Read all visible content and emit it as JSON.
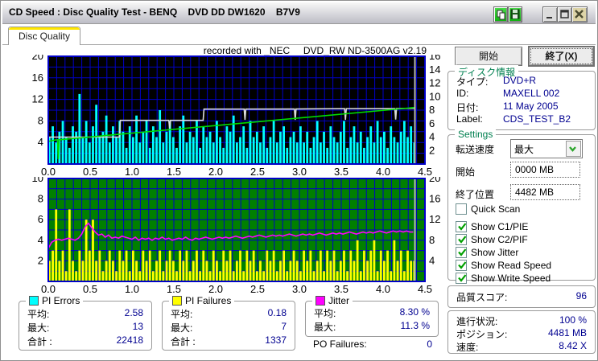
{
  "window": {
    "title": "CD Speed : Disc Quality Test - BENQ    DVD DD DW1620    B7V9",
    "controls": [
      "copy-icon",
      "save-icon",
      "minimize-icon",
      "maximize-icon",
      "close-icon"
    ]
  },
  "tab": {
    "label": "Disc Quality"
  },
  "recorded_with": "recorded with _NEC     DVD_RW ND-3500AG v2.19",
  "chart_data": [
    {
      "type": "bar",
      "name": "PI Errors with read/write speed overlay",
      "x_unit": "GB",
      "x_step": 0.04,
      "xlim": [
        0,
        4.5
      ],
      "ylim_left": [
        0,
        20
      ],
      "ylim_right": [
        0,
        16
      ],
      "grid_y_step": 2,
      "grid_x_step": 0.1,
      "x_ticks": [
        "0.0",
        "0.5",
        "1.0",
        "1.5",
        "2.0",
        "2.5",
        "3.0",
        "3.5",
        "4.0",
        "4.5"
      ],
      "left_ticks": [
        20,
        16,
        12,
        8,
        4
      ],
      "right_ticks": [
        16,
        14,
        12,
        10,
        8,
        6,
        4,
        2
      ],
      "bg": "#000000",
      "grid_color": "#0000c8",
      "cursor_x": 4.38,
      "cursor_color": "#b8b8b8",
      "bars": {
        "name": "PI Errors",
        "color": "#00ffff",
        "values": [
          5,
          7,
          4,
          6,
          8,
          5,
          3,
          7,
          6,
          13,
          5,
          8,
          4,
          7,
          11,
          5,
          6,
          9,
          4,
          7,
          5,
          8,
          6,
          3,
          7,
          5,
          9,
          4,
          6,
          8,
          3,
          7,
          5,
          10,
          4,
          6,
          8,
          5,
          3,
          7,
          9,
          4,
          6,
          5,
          8,
          3,
          7,
          5,
          6,
          4,
          8,
          5,
          3,
          7,
          6,
          9,
          4,
          5,
          7,
          3,
          8,
          5,
          6,
          4,
          7,
          3,
          5,
          8,
          4,
          6,
          7,
          3,
          5,
          6,
          4,
          7,
          4,
          6,
          3,
          5,
          8,
          4,
          6,
          3,
          7,
          5,
          4,
          6,
          8,
          3,
          5,
          7,
          4,
          6,
          3,
          5,
          7,
          4,
          8,
          5,
          6,
          3,
          7,
          5,
          4,
          6,
          8,
          5,
          7,
          4
        ]
      },
      "lines": [
        {
          "name": "Write Speed",
          "color": "#dcdcdc",
          "axis": "left-units",
          "points": [
            [
              0,
              5.0
            ],
            [
              0.85,
              5.0
            ],
            [
              0.86,
              8.1
            ],
            [
              1.44,
              8.1
            ],
            [
              1.45,
              6.6
            ],
            [
              1.46,
              8.1
            ],
            [
              1.85,
              8.1
            ],
            [
              1.86,
              10.2
            ],
            [
              2.34,
              10.2
            ],
            [
              2.35,
              8.2
            ],
            [
              2.36,
              10.2
            ],
            [
              2.94,
              10.22
            ],
            [
              2.95,
              8.2
            ],
            [
              2.96,
              10.22
            ],
            [
              3.54,
              10.28
            ],
            [
              3.55,
              8.2
            ],
            [
              3.56,
              10.28
            ],
            [
              4.14,
              10.3
            ],
            [
              4.15,
              8.25
            ],
            [
              4.16,
              10.3
            ],
            [
              4.38,
              10.35
            ]
          ]
        },
        {
          "name": "Read Speed",
          "color": "#00dc00",
          "axis": "left-units",
          "points": [
            [
              0,
              4.2
            ],
            [
              0.08,
              4.45
            ],
            [
              0.11,
              4.5
            ],
            [
              0.12,
              0.9
            ],
            [
              0.13,
              4.5
            ],
            [
              4.38,
              10.5
            ]
          ]
        }
      ]
    },
    {
      "type": "bar",
      "name": "PI Failures with jitter overlay",
      "x_unit": "GB",
      "x_step": 0.04,
      "xlim": [
        0,
        4.5
      ],
      "ylim_left": [
        0,
        10
      ],
      "ylim_right": [
        0,
        20
      ],
      "grid_y_step": 1,
      "grid_x_step": 0.1,
      "x_ticks": [
        "0.0",
        "0.5",
        "1.0",
        "1.5",
        "2.0",
        "2.5",
        "3.0",
        "3.5",
        "4.0",
        "4.5"
      ],
      "left_ticks": [
        10,
        8,
        6,
        4,
        2
      ],
      "right_ticks": [
        20,
        16,
        12,
        8,
        4
      ],
      "bg": "#008000",
      "grid_color": "#0000c8",
      "cursor_x": 4.38,
      "cursor_color": "#b8b8b8",
      "bars": {
        "name": "PI Failures",
        "color": "#ffff00",
        "values": [
          2,
          3,
          7,
          2,
          3,
          1,
          7,
          2,
          1,
          3,
          2,
          6,
          3,
          6,
          2,
          3,
          1,
          2,
          3,
          2,
          1,
          3,
          2,
          3,
          1,
          3,
          2,
          1,
          3,
          2,
          3,
          1,
          2,
          3,
          1,
          2,
          3,
          2,
          1,
          3,
          2,
          3,
          1,
          2,
          3,
          1,
          3,
          2,
          1,
          3,
          2,
          1,
          3,
          2,
          3,
          1,
          2,
          3,
          1,
          3,
          2,
          3,
          1,
          2,
          1,
          3,
          2,
          3,
          1,
          2,
          3,
          1,
          2,
          3,
          2,
          1,
          3,
          2,
          3,
          1,
          2,
          3,
          1,
          3,
          2,
          3,
          1,
          2,
          3,
          1,
          3,
          2,
          4,
          1,
          3,
          2,
          3,
          4,
          1,
          3,
          2,
          3,
          1,
          4,
          2,
          3,
          1,
          3,
          2,
          2
        ]
      },
      "lines": [
        {
          "name": "Jitter",
          "color": "#ff00ff",
          "axis": "left-units",
          "values": [
            3.2,
            3.8,
            4.0,
            4.1,
            4.0,
            4.1,
            4.2,
            4.1,
            4.0,
            4.2,
            4.6,
            5.3,
            5.65,
            5.2,
            4.8,
            4.5,
            4.6,
            4.3,
            4.5,
            4.2,
            4.3,
            4.2,
            4.4,
            4.3,
            4.2,
            4.1,
            4.3,
            4.0,
            4.2,
            4.1,
            4.2,
            4.0,
            4.2,
            4.1,
            4.3,
            4.1,
            4.2,
            4.0,
            4.1,
            4.2,
            4.1,
            4.3,
            4.1,
            4.0,
            4.2,
            4.1,
            4.2,
            4.3,
            4.2,
            4.1,
            4.2,
            4.3,
            4.2,
            4.3,
            4.2,
            4.3,
            4.4,
            4.3,
            4.2,
            4.3,
            4.4,
            4.3,
            4.4,
            4.5,
            4.4,
            4.3,
            4.4,
            4.5,
            4.4,
            4.5,
            4.4,
            4.5,
            4.6,
            4.5,
            4.4,
            4.5,
            4.6,
            4.5,
            4.6,
            4.5,
            4.6,
            4.7,
            4.6,
            4.5,
            4.6,
            4.7,
            4.6,
            4.7,
            4.6,
            4.7,
            4.8,
            4.7,
            4.6,
            4.7,
            4.8,
            4.7,
            4.8,
            4.7,
            4.8,
            4.9,
            4.8,
            4.7,
            4.8,
            4.9,
            4.8,
            4.9,
            4.8,
            4.9,
            4.8,
            4.8
          ]
        }
      ]
    }
  ],
  "stats": {
    "pi_errors": {
      "name": "PI Errors",
      "color": "#00ffff",
      "rows": [
        [
          "平均:",
          "2.58"
        ],
        [
          "最大:",
          "13"
        ],
        [
          "合計 :",
          "22418"
        ]
      ]
    },
    "pi_failures": {
      "name": "PI Failures",
      "color": "#ffff00",
      "rows": [
        [
          "平均:",
          "0.18"
        ],
        [
          "最大:",
          "7"
        ],
        [
          "合計 :",
          "1337"
        ]
      ]
    },
    "jitter": {
      "name": "Jitter",
      "color": "#ff00ff",
      "rows": [
        [
          "平均:",
          "8.30 %"
        ],
        [
          "最大:",
          "11.3 %"
        ]
      ]
    },
    "po_failures": {
      "label": "PO Failures:",
      "value": "0"
    }
  },
  "sidebar": {
    "start_button": "開始",
    "exit_button": "終了(X)",
    "disc_info": {
      "title": "ディスク情報",
      "rows": [
        [
          "タイプ:",
          "DVD+R"
        ],
        [
          "ID:",
          "MAXELL 002"
        ],
        [
          "日付:",
          "11 May 2005"
        ],
        [
          "Label:",
          "CDS_TEST_B2"
        ]
      ]
    },
    "settings": {
      "title": "Settings",
      "speed_label": "転送速度",
      "speed_value": "最大",
      "start_label": "開始",
      "start_value": "0000 MB",
      "end_label": "終了位置",
      "end_value": "4482 MB",
      "checkboxes": [
        {
          "label": "Quick Scan",
          "checked": false
        },
        {
          "label": "Show C1/PIE",
          "checked": true
        },
        {
          "label": "Show C2/PIF",
          "checked": true
        },
        {
          "label": "Show Jitter",
          "checked": true
        },
        {
          "label": "Show Read Speed",
          "checked": true
        },
        {
          "label": "Show Write Speed",
          "checked": true
        }
      ]
    },
    "score": {
      "label": "品質スコア:",
      "value": "96"
    },
    "progress": {
      "rows": [
        [
          "進行状況:",
          "100 %"
        ],
        [
          "ポジション:",
          "4481 MB"
        ],
        [
          "速度:",
          "8.42 X"
        ]
      ]
    }
  },
  "colors": {
    "tab_highlight": "#ffe600",
    "value_text": "#000090",
    "group_title": "#008050",
    "check": "#00a000"
  }
}
